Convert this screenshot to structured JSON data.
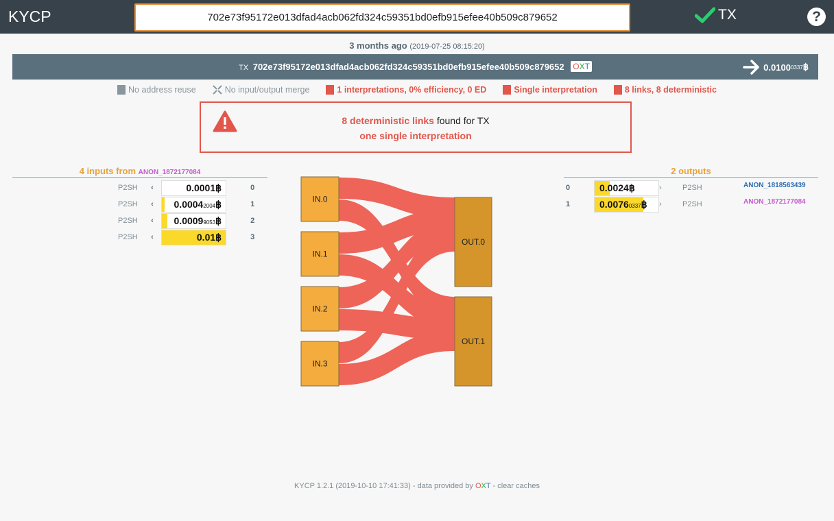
{
  "app": {
    "title": "KYCP"
  },
  "search": {
    "value": "702e73f95172e013dfad4acb062fd324c59351bd0efb915efee40b509c879652"
  },
  "status": {
    "label": "TX"
  },
  "time": {
    "relative": "3 months ago",
    "absolute": "(2019-07-25 08:15:20)"
  },
  "tx": {
    "label": "TX",
    "hash": "702e73f95172e013dfad4acb062fd324c59351bd0efb915efee40b509c879652",
    "badge": {
      "o": "O",
      "x": "X",
      "t": "T"
    },
    "amount_main": "0.0100",
    "amount_small": "0337",
    "currency": "฿"
  },
  "legend": [
    {
      "text": "No address reuse",
      "color": "#8a969e"
    },
    {
      "text": "No input/output merge",
      "color": "#8a969e"
    },
    {
      "text": "1 interpretations, 0% efficiency, 0 ED",
      "color": "#e2564b"
    },
    {
      "text": "Single interpretation",
      "color": "#e2564b"
    },
    {
      "text": "8 links, 8 deterministic",
      "color": "#e2564b"
    }
  ],
  "alert": {
    "highlight": "8 deterministic links",
    "rest": " found for TX",
    "line2": "one single interpretation"
  },
  "inputs": {
    "heading": "4 inputs from",
    "owner": "ANON_1872177084",
    "rows": [
      {
        "type": "P2SH",
        "main": "0.0001",
        "small": "",
        "index": "0",
        "fill": 0.0
      },
      {
        "type": "P2SH",
        "main": "0.0004",
        "small": "2004",
        "index": "1",
        "fill": 0.04
      },
      {
        "type": "P2SH",
        "main": "0.0009",
        "small": "9053",
        "index": "2",
        "fill": 0.09
      },
      {
        "type": "P2SH",
        "main": "0.01",
        "small": "",
        "index": "3",
        "fill": 1.0
      }
    ]
  },
  "outputs": {
    "heading": "2 outputs",
    "rows": [
      {
        "index": "0",
        "main": "0.0024",
        "small": "",
        "type": "P2SH",
        "owner": "ANON_1818563439",
        "owner_color": "#2b6cb5",
        "fill": 0.24
      },
      {
        "index": "1",
        "main": "0.0076",
        "small": "0337",
        "type": "P2SH",
        "owner": "ANON_1872177084",
        "owner_color": "#c45bcf",
        "fill": 0.76
      }
    ]
  },
  "sankey": {
    "inputs": [
      "IN.0",
      "IN.1",
      "IN.2",
      "IN.3"
    ],
    "outputs": [
      "OUT.0",
      "OUT.1"
    ]
  },
  "footer": {
    "version": "KYCP 1.2.1 (2019-10-10 17:41:33) - data provided by ",
    "o": "O",
    "x": "X",
    "t": "T",
    "sep": " - ",
    "clear": "clear caches"
  },
  "colors": {
    "link": "#ee6459",
    "in_node": "#f3ac3d",
    "out_node": "#d6952b",
    "accent": "#e8913a",
    "fill": "#fad92b"
  }
}
